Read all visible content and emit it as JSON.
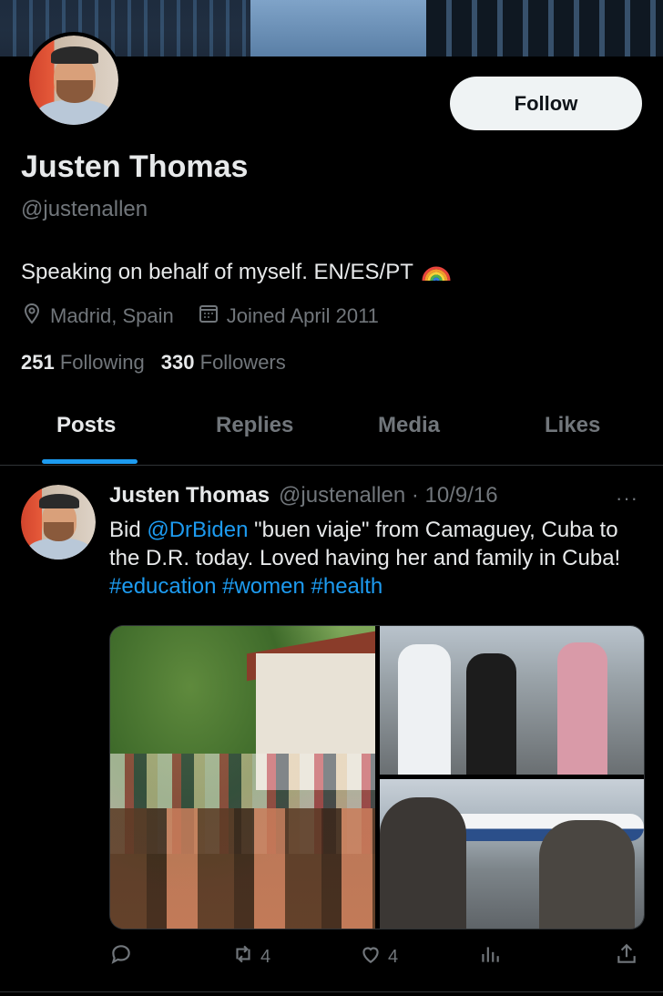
{
  "profile": {
    "name": "Justen Thomas",
    "handle": "@justenallen",
    "bio": "Speaking on behalf of myself. EN/ES/PT",
    "location": "Madrid, Spain",
    "joined": "Joined April 2011",
    "following_count": "251",
    "following_label": "Following",
    "followers_count": "330",
    "followers_label": "Followers",
    "follow_label": "Follow"
  },
  "tabs": [
    {
      "label": "Posts",
      "active": true
    },
    {
      "label": "Replies",
      "active": false
    },
    {
      "label": "Media",
      "active": false
    },
    {
      "label": "Likes",
      "active": false
    }
  ],
  "post": {
    "author": "Justen Thomas",
    "handle_date": "@justenallen · 10/9/16",
    "more": "···",
    "text_pre": "Bid ",
    "mention": "@DrBiden",
    "text_mid": " \"buen viaje\" from Camaguey, Cuba to the D.R. today. Loved having her and family in Cuba! ",
    "hashtags": [
      "#education",
      "#women",
      "#health"
    ],
    "replies": "",
    "reposts": "4",
    "likes": "4"
  },
  "colors": {
    "accent": "#1d9bf0",
    "background": "#000000",
    "text": "#e7e9ea",
    "muted": "#71767b"
  },
  "icons": [
    "location-icon",
    "calendar-icon",
    "rainbow-icon",
    "reply-icon",
    "repost-icon",
    "like-icon",
    "views-icon",
    "share-icon"
  ]
}
